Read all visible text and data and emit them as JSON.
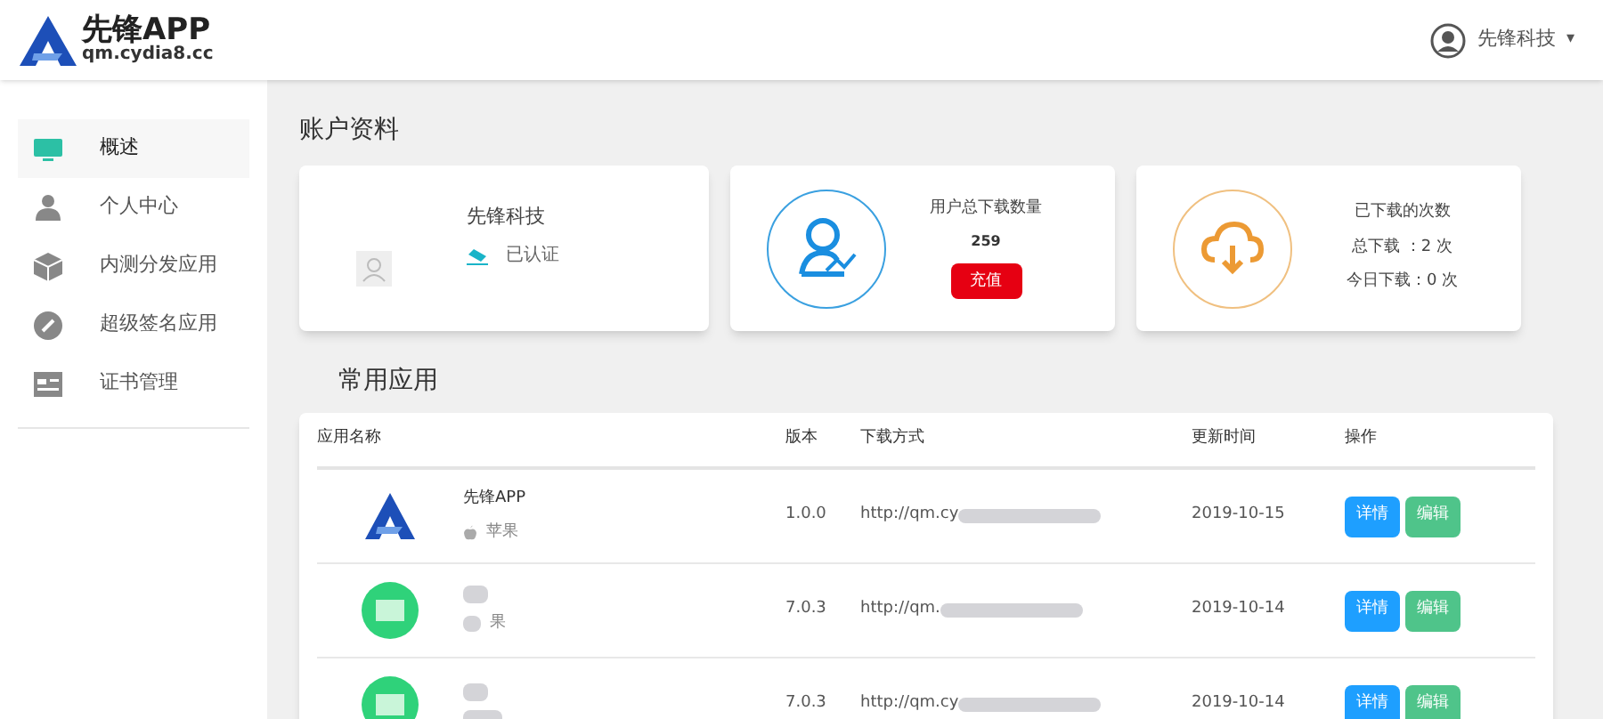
{
  "header": {
    "logo_title": "先锋APP",
    "logo_subtitle": "qm.cydia8.cc",
    "user": "先锋科技",
    "caret": "▾"
  },
  "sidebar": {
    "items": [
      {
        "label": "概述",
        "kind": "monitor",
        "selected": true
      },
      {
        "label": "个人中心",
        "kind": "person",
        "selected": false
      },
      {
        "label": "内测分发应用",
        "kind": "box",
        "selected": false
      },
      {
        "label": "超级签名应用",
        "kind": "pencil",
        "selected": false
      },
      {
        "label": "证书管理",
        "kind": "card",
        "selected": false
      }
    ]
  },
  "account": {
    "title": "账户资料",
    "name": "先锋科技",
    "status": "已认证",
    "downloads_label": "用户总下载数量",
    "downloads_count": "259",
    "recharge_button": "充值",
    "stats_title": "已下载的次数",
    "total_line": "总下载 ：2 次",
    "today_line": "今日下载：0 次"
  },
  "apps": {
    "title": "常用应用",
    "columns": [
      "应用名称",
      "版本",
      "下载方式",
      "更新时间",
      "操作"
    ],
    "rows": [
      {
        "kind": "logo",
        "name": "先锋APP",
        "platform": "苹果",
        "version": "1.0.0",
        "url": "http://qm.cy",
        "date": "2019-10-15",
        "detail_button": "详情",
        "edit_button": "编辑"
      },
      {
        "kind": "pixelated",
        "name": "",
        "platform": "果",
        "version": "7.0.3",
        "url": "http://qm.",
        "date": "2019-10-14",
        "detail_button": "详情",
        "edit_button": "编辑"
      },
      {
        "kind": "pixelated",
        "name": "",
        "platform": "",
        "version": "7.0.3",
        "url": "http://qm.cy",
        "date": "2019-10-14",
        "detail_button": "详情",
        "edit_button": "编辑"
      }
    ]
  }
}
